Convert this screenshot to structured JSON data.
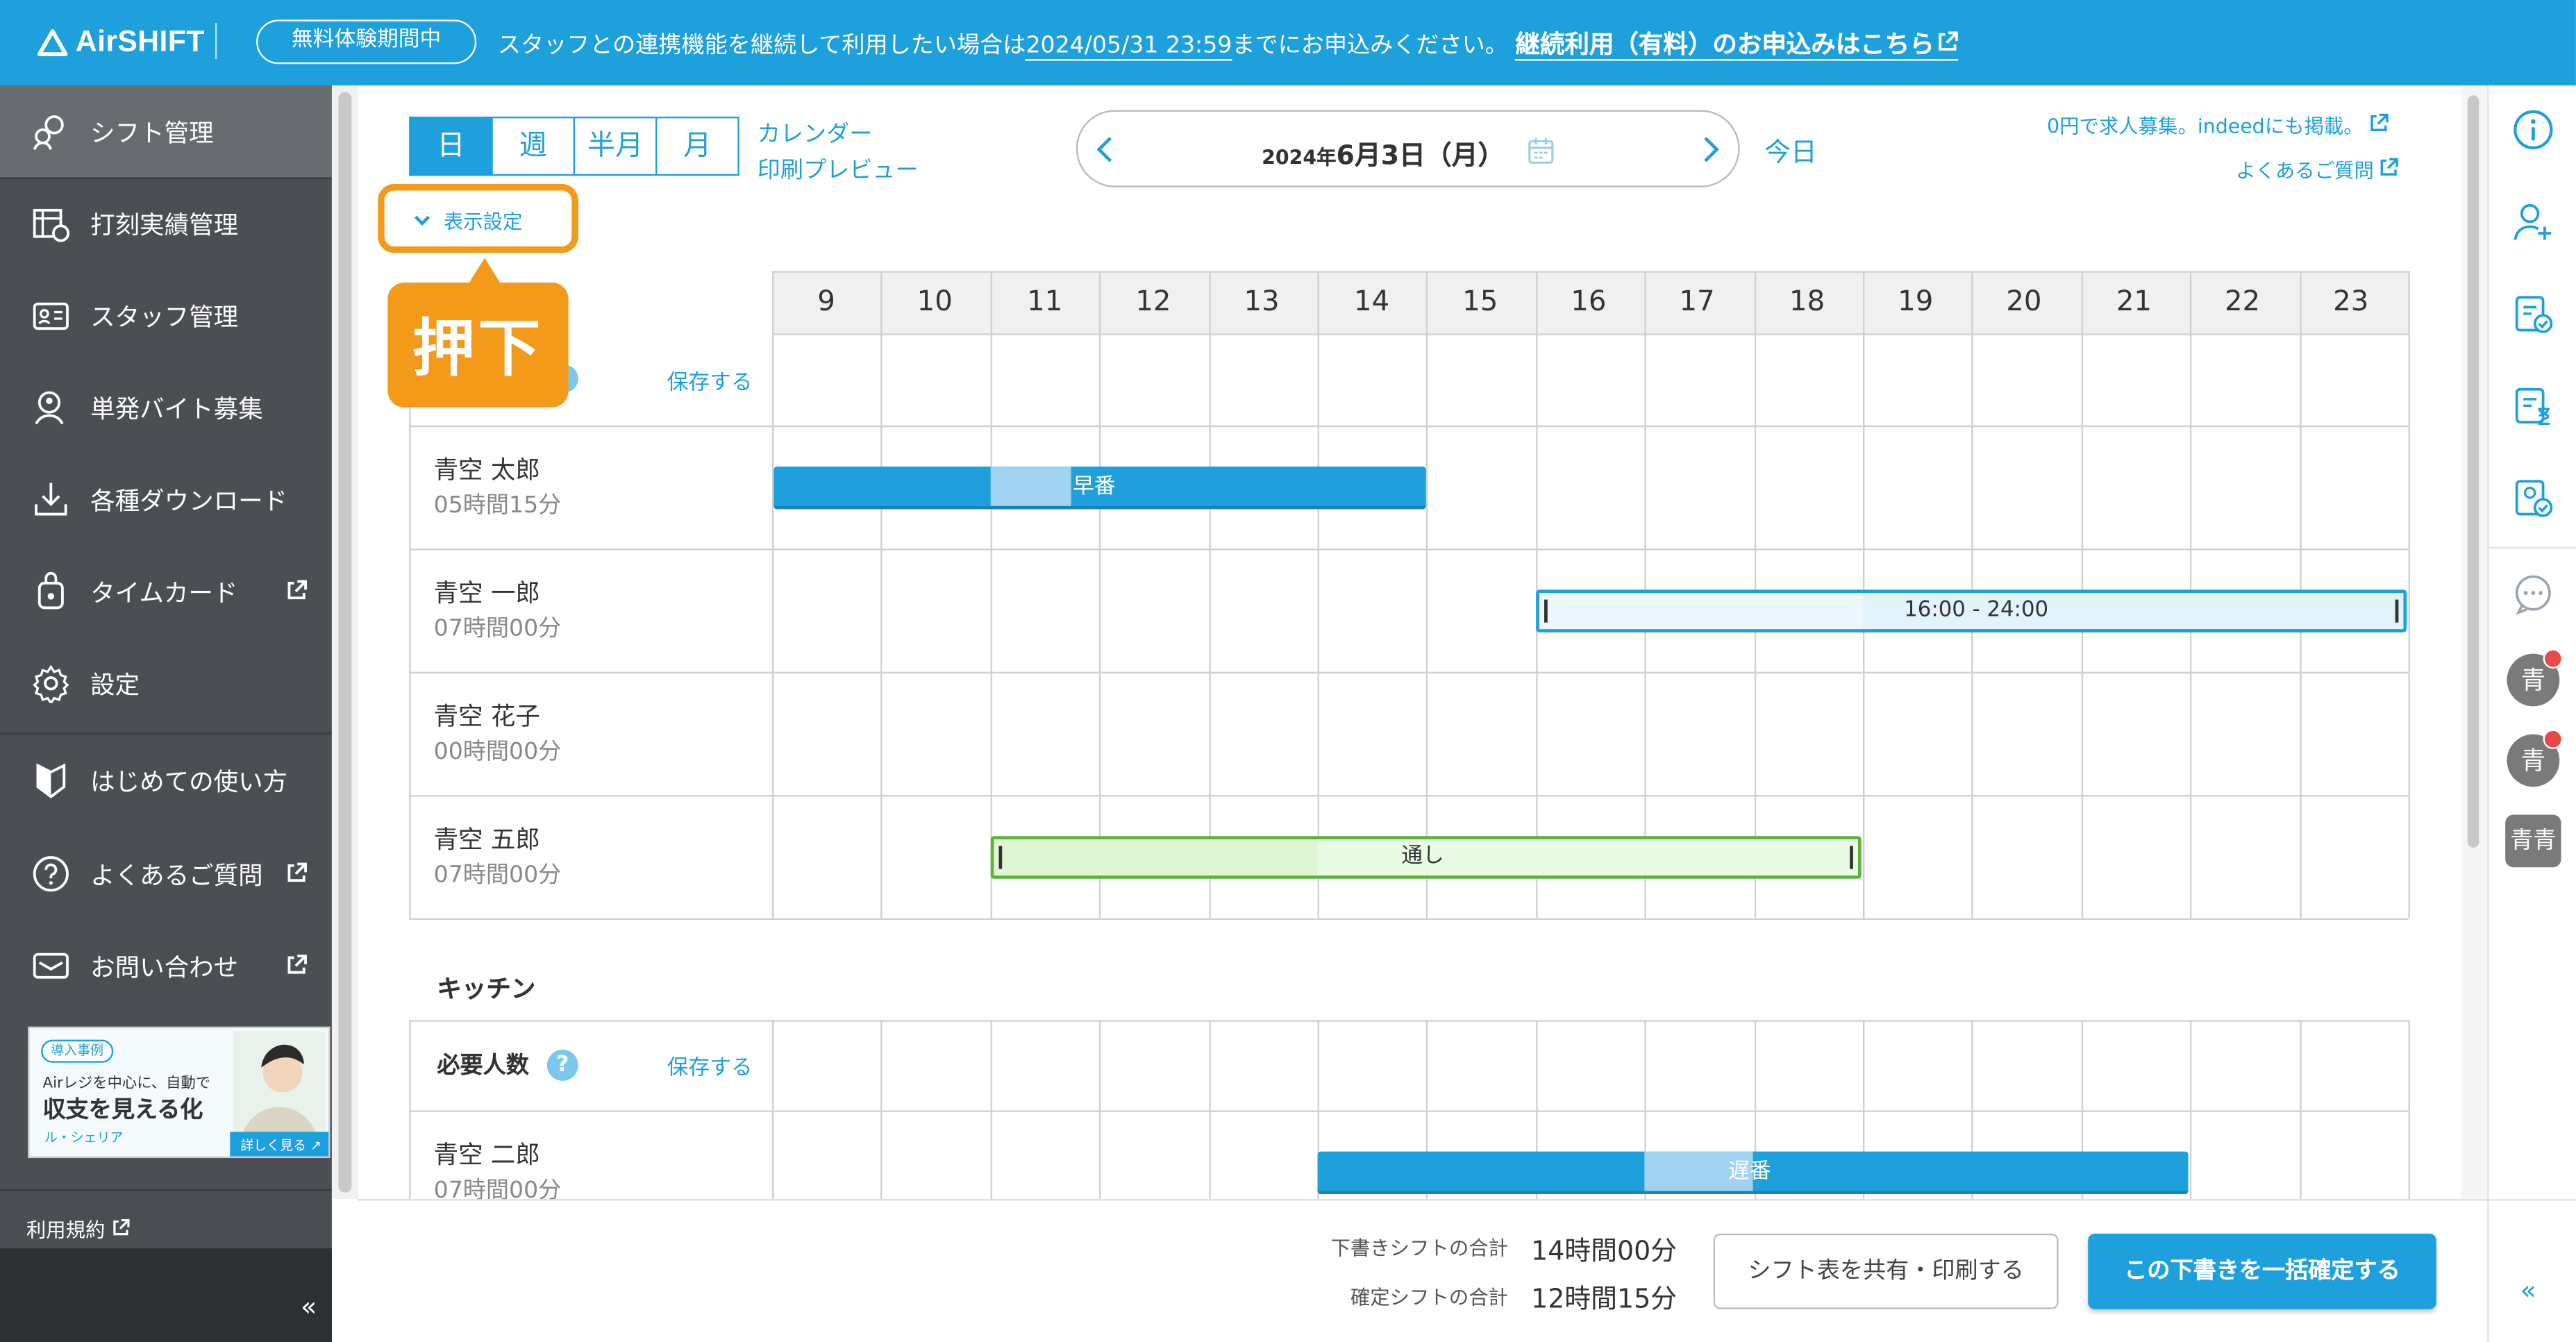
{
  "topbar": {
    "logo": "AirSHIFT",
    "trial_badge": "無料体験期間中",
    "notice_pre": "スタッフとの連携機能を継続して利用したい場合は",
    "notice_date": "2024/05/31 23:59",
    "notice_post": "までにお申込みください。",
    "notice_link": "継続利用（有料）のお申込みはこちら"
  },
  "sidebar": {
    "items": [
      {
        "label": "シフト管理",
        "icon": "shift-icon",
        "external": false,
        "active": true
      },
      {
        "label": "打刻実績管理",
        "icon": "timeclock-icon",
        "external": false
      },
      {
        "label": "スタッフ管理",
        "icon": "staff-card-icon",
        "external": false
      },
      {
        "label": "単発バイト募集",
        "icon": "recruit-icon",
        "external": false
      },
      {
        "label": "各種ダウンロード",
        "icon": "download-icon",
        "external": false
      },
      {
        "label": "タイムカード",
        "icon": "timecard-icon",
        "external": true
      },
      {
        "label": "設定",
        "icon": "gear-icon",
        "external": false
      },
      {
        "label": "はじめての使い方",
        "icon": "beginner-mark-icon",
        "external": false
      },
      {
        "label": "よくあるご質問",
        "icon": "question-icon",
        "external": true
      },
      {
        "label": "お問い合わせ",
        "icon": "mail-icon",
        "external": true
      }
    ],
    "ad": {
      "tag": "導入事例",
      "line1": "Airレジを中心に、自動で",
      "line2": "収支を見える化",
      "brand": "ル・シェリア",
      "more": "詳しく見る"
    },
    "terms": "利用規約",
    "collapse": "«"
  },
  "toolbar": {
    "views": [
      "日",
      "週",
      "半月",
      "月"
    ],
    "selected_view": "日",
    "calendar_link": "カレンダー",
    "print_preview_link": "印刷プレビュー",
    "date_prefix": "2024年",
    "date_main": "6月3日（月）",
    "today": "今日",
    "display_settings": "表示設定",
    "callout": "押下",
    "recruit_link": "0円で求人募集。indeedにも掲載。",
    "faq_link": "よくあるご質問"
  },
  "schedule": {
    "hours": [
      "9",
      "10",
      "11",
      "12",
      "13",
      "14",
      "15",
      "16",
      "17",
      "18",
      "19",
      "20",
      "21",
      "22",
      "23"
    ],
    "save_label": "保存する",
    "hall_rows": [
      {
        "name": "青空 太郎",
        "hours": "05時間15分"
      },
      {
        "name": "青空 一郎",
        "hours": "07時間00分"
      },
      {
        "name": "青空 花子",
        "hours": "00時間00分"
      },
      {
        "name": "青空 五郎",
        "hours": "07時間00分"
      }
    ],
    "bars": {
      "taro": "早番",
      "ichiro": "16:00 - 24:00",
      "goro": "通し",
      "jiro": "遅番"
    },
    "kitchen_title": "キッチン",
    "required_label": "必要人数",
    "kitchen_rows": [
      {
        "name": "青空 二郎",
        "hours": "07時間00分"
      }
    ]
  },
  "footer": {
    "draft_label": "下書きシフトの合計",
    "draft_value": "14時間00分",
    "confirmed_label": "確定シフトの合計",
    "confirmed_value": "12時間15分",
    "share_button": "シフト表を共有・印刷する",
    "confirm_button": "この下書きを一括確定する"
  },
  "rightbar": {
    "avatar1": "青",
    "avatar2": "青",
    "avatar3": "青青",
    "collapse": "«"
  },
  "colors": {
    "brand": "#1ea0dc",
    "sidebar": "#4b4e53",
    "accent_orange": "#f39a1b",
    "early_bar": "#1ea0dc",
    "late_bar_light": "#e3f3fc",
    "full_bar_green": "#eafbe3"
  }
}
